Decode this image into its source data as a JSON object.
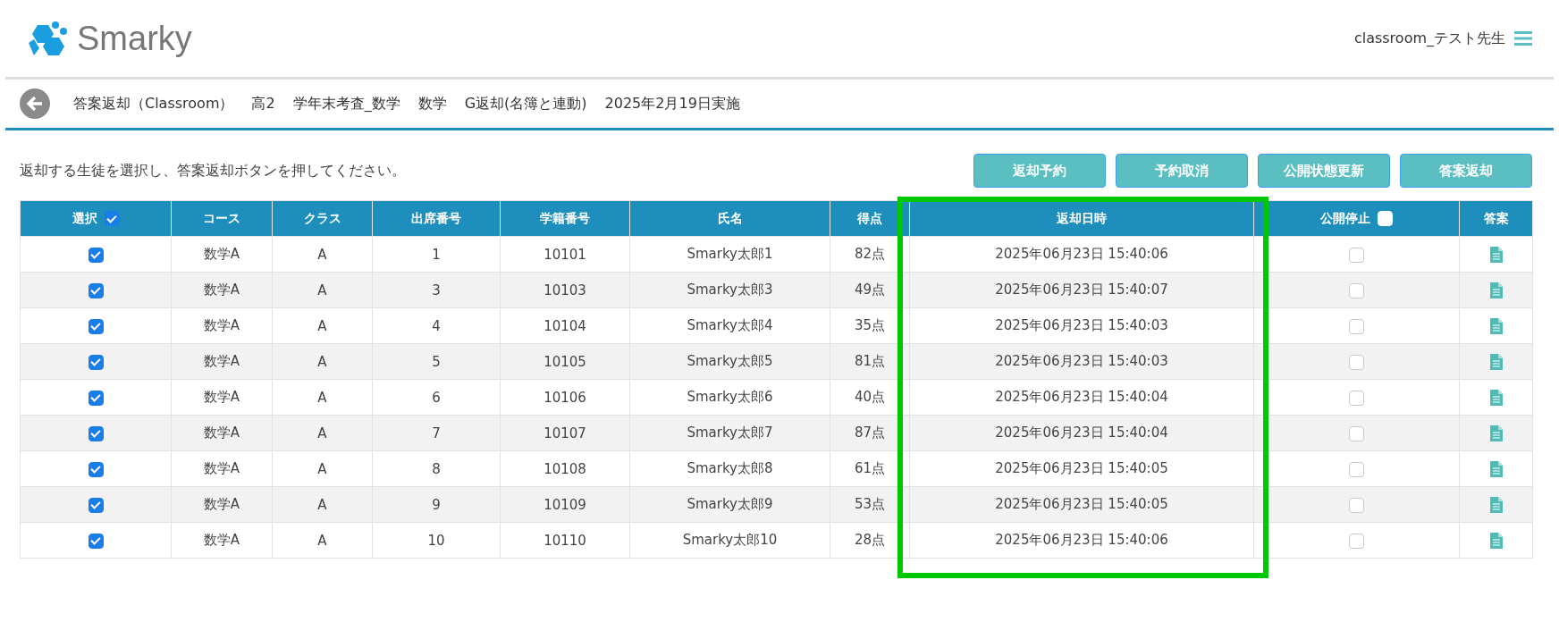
{
  "header": {
    "logo_text": "Smarky",
    "user": "classroom_テスト先生"
  },
  "breadcrumb": {
    "items": [
      "答案返却（Classroom）",
      "高2",
      "学年末考査_数学",
      "数学",
      "G返却(名簿と連動)",
      "2025年2月19日実施"
    ]
  },
  "instruction": "返却する生徒を選択し、答案返却ボタンを押してください。",
  "buttons": [
    "返却予約",
    "予約取消",
    "公開状態更新",
    "答案返却"
  ],
  "table": {
    "columns": [
      {
        "label": "選択",
        "kind": "checkbox",
        "checked": true
      },
      {
        "label": "コース",
        "kind": "text"
      },
      {
        "label": "クラス",
        "kind": "text"
      },
      {
        "label": "出席番号",
        "kind": "text"
      },
      {
        "label": "学籍番号",
        "kind": "text"
      },
      {
        "label": "氏名",
        "kind": "text"
      },
      {
        "label": "得点",
        "kind": "text"
      },
      {
        "label": "返却日時",
        "kind": "text"
      },
      {
        "label": "公開停止",
        "kind": "checkbox",
        "checked": false
      },
      {
        "label": "答案",
        "kind": "text"
      }
    ],
    "rows": [
      {
        "selected": true,
        "course": "数学A",
        "class": "A",
        "seat": "1",
        "student_id": "10101",
        "name": "Smarky太郎1",
        "score": "82点",
        "returned_at": "2025年06月23日 15:40:06",
        "suspended": false
      },
      {
        "selected": true,
        "course": "数学A",
        "class": "A",
        "seat": "3",
        "student_id": "10103",
        "name": "Smarky太郎3",
        "score": "49点",
        "returned_at": "2025年06月23日 15:40:07",
        "suspended": false
      },
      {
        "selected": true,
        "course": "数学A",
        "class": "A",
        "seat": "4",
        "student_id": "10104",
        "name": "Smarky太郎4",
        "score": "35点",
        "returned_at": "2025年06月23日 15:40:03",
        "suspended": false
      },
      {
        "selected": true,
        "course": "数学A",
        "class": "A",
        "seat": "5",
        "student_id": "10105",
        "name": "Smarky太郎5",
        "score": "81点",
        "returned_at": "2025年06月23日 15:40:03",
        "suspended": false
      },
      {
        "selected": true,
        "course": "数学A",
        "class": "A",
        "seat": "6",
        "student_id": "10106",
        "name": "Smarky太郎6",
        "score": "40点",
        "returned_at": "2025年06月23日 15:40:04",
        "suspended": false
      },
      {
        "selected": true,
        "course": "数学A",
        "class": "A",
        "seat": "7",
        "student_id": "10107",
        "name": "Smarky太郎7",
        "score": "87点",
        "returned_at": "2025年06月23日 15:40:04",
        "suspended": false
      },
      {
        "selected": true,
        "course": "数学A",
        "class": "A",
        "seat": "8",
        "student_id": "10108",
        "name": "Smarky太郎8",
        "score": "61点",
        "returned_at": "2025年06月23日 15:40:05",
        "suspended": false
      },
      {
        "selected": true,
        "course": "数学A",
        "class": "A",
        "seat": "9",
        "student_id": "10109",
        "name": "Smarky太郎9",
        "score": "53点",
        "returned_at": "2025年06月23日 15:40:05",
        "suspended": false
      },
      {
        "selected": true,
        "course": "数学A",
        "class": "A",
        "seat": "10",
        "student_id": "10110",
        "name": "Smarky太郎10",
        "score": "28点",
        "returned_at": "2025年06月23日 15:40:06",
        "suspended": false
      }
    ]
  }
}
